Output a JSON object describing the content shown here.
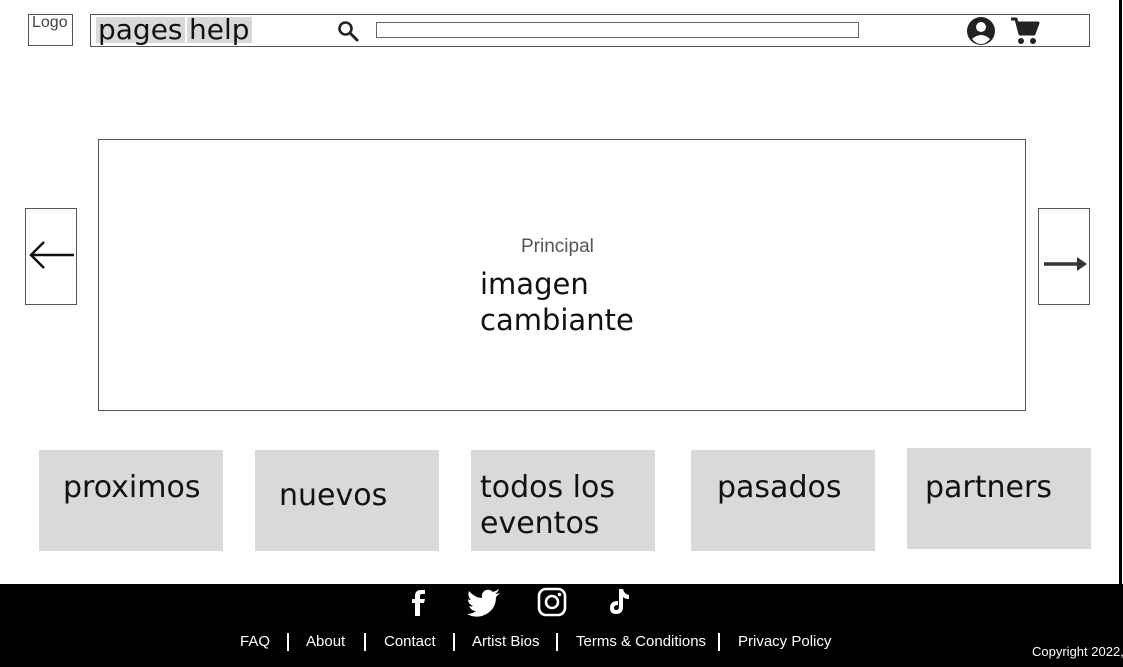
{
  "header": {
    "logo_text": "Logo",
    "nav_links": [
      "pages",
      "help"
    ],
    "search_value": "",
    "icons": [
      "search-icon",
      "account-icon",
      "cart-icon"
    ]
  },
  "carousel": {
    "caption": "Principal",
    "text_line1": "imagen",
    "text_line2": "cambiante",
    "icons": [
      "arrow-left-icon",
      "arrow-right-icon"
    ]
  },
  "categories": {
    "proximos": "proximos",
    "nuevos": "nuevos",
    "todos_line1": "todos los",
    "todos_line2": "eventos",
    "pasados": "pasados",
    "partners": "partners"
  },
  "footer": {
    "social_icons": [
      "facebook-icon",
      "twitter-icon",
      "instagram-icon",
      "tiktok-icon"
    ],
    "links": [
      "FAQ",
      "About",
      "Contact",
      "Artist Bios",
      "Terms & Conditions",
      "Privacy Policy"
    ],
    "copyright": "Copyright 2022,"
  },
  "colors": {
    "background": "#ffffff",
    "tile_gray": "#d9d9d9",
    "footer_bg": "#000000",
    "border": "#555555"
  }
}
